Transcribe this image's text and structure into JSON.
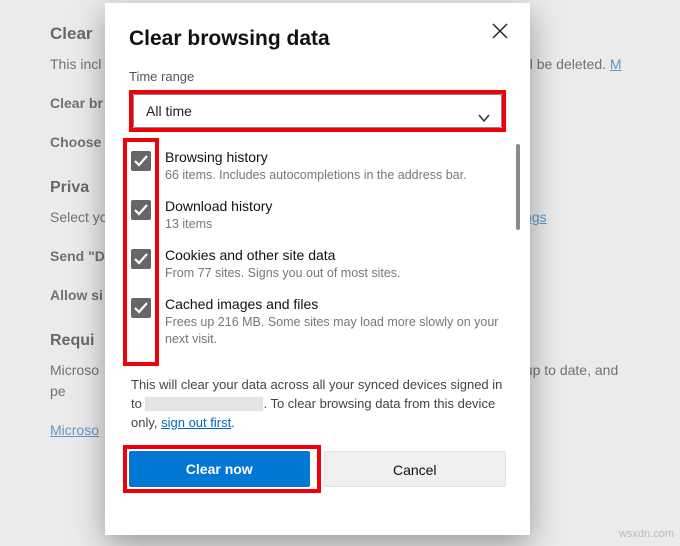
{
  "bg": {
    "h_clear": "Clear",
    "p_clear": "This incl",
    "p_clear_tail": "rofile will be deleted. ",
    "link_m": "M",
    "l_clear_br": "Clear br",
    "l_choose": "Choose",
    "h_priv": "Priva",
    "p_select": "Select yo",
    "link_settings": "ettings",
    "l_send": "Send \"D",
    "l_allow": "Allow si",
    "h_req": "Requi",
    "p_ms": "Microso",
    "p_ms_tail": "ure, up to date, and pe",
    "link_ms": "Microso"
  },
  "dialog": {
    "title": "Clear browsing data",
    "time_range_label": "Time range",
    "time_range_value": "All time",
    "items": [
      {
        "title": "Browsing history",
        "sub": "66 items. Includes autocompletions in the address bar."
      },
      {
        "title": "Download history",
        "sub": "13 items"
      },
      {
        "title": "Cookies and other site data",
        "sub": "From 77 sites. Signs you out of most sites."
      },
      {
        "title": "Cached images and files",
        "sub": "Frees up 216 MB. Some sites may load more slowly on your next visit."
      }
    ],
    "sync_note_1": "This will clear your data across all your synced devices signed in to ",
    "sync_note_2": ". To clear browsing data from this device only, ",
    "sign_out_link": "sign out first",
    "clear_btn": "Clear now",
    "cancel_btn": "Cancel"
  },
  "watermark": "wsxdn.com"
}
